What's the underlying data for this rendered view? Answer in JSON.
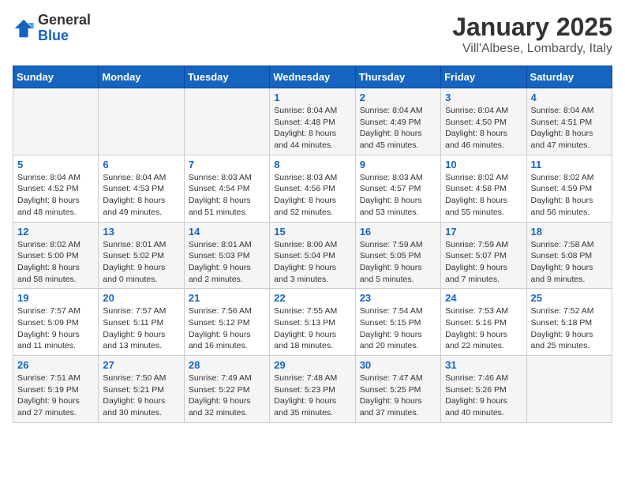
{
  "header": {
    "logo_general": "General",
    "logo_blue": "Blue",
    "title": "January 2025",
    "subtitle": "Vill'Albese, Lombardy, Italy"
  },
  "days_of_week": [
    "Sunday",
    "Monday",
    "Tuesday",
    "Wednesday",
    "Thursday",
    "Friday",
    "Saturday"
  ],
  "weeks": [
    [
      {
        "day": "",
        "info": ""
      },
      {
        "day": "",
        "info": ""
      },
      {
        "day": "",
        "info": ""
      },
      {
        "day": "1",
        "info": "Sunrise: 8:04 AM\nSunset: 4:48 PM\nDaylight: 8 hours\nand 44 minutes."
      },
      {
        "day": "2",
        "info": "Sunrise: 8:04 AM\nSunset: 4:49 PM\nDaylight: 8 hours\nand 45 minutes."
      },
      {
        "day": "3",
        "info": "Sunrise: 8:04 AM\nSunset: 4:50 PM\nDaylight: 8 hours\nand 46 minutes."
      },
      {
        "day": "4",
        "info": "Sunrise: 8:04 AM\nSunset: 4:51 PM\nDaylight: 8 hours\nand 47 minutes."
      }
    ],
    [
      {
        "day": "5",
        "info": "Sunrise: 8:04 AM\nSunset: 4:52 PM\nDaylight: 8 hours\nand 48 minutes."
      },
      {
        "day": "6",
        "info": "Sunrise: 8:04 AM\nSunset: 4:53 PM\nDaylight: 8 hours\nand 49 minutes."
      },
      {
        "day": "7",
        "info": "Sunrise: 8:03 AM\nSunset: 4:54 PM\nDaylight: 8 hours\nand 51 minutes."
      },
      {
        "day": "8",
        "info": "Sunrise: 8:03 AM\nSunset: 4:56 PM\nDaylight: 8 hours\nand 52 minutes."
      },
      {
        "day": "9",
        "info": "Sunrise: 8:03 AM\nSunset: 4:57 PM\nDaylight: 8 hours\nand 53 minutes."
      },
      {
        "day": "10",
        "info": "Sunrise: 8:02 AM\nSunset: 4:58 PM\nDaylight: 8 hours\nand 55 minutes."
      },
      {
        "day": "11",
        "info": "Sunrise: 8:02 AM\nSunset: 4:59 PM\nDaylight: 8 hours\nand 56 minutes."
      }
    ],
    [
      {
        "day": "12",
        "info": "Sunrise: 8:02 AM\nSunset: 5:00 PM\nDaylight: 8 hours\nand 58 minutes."
      },
      {
        "day": "13",
        "info": "Sunrise: 8:01 AM\nSunset: 5:02 PM\nDaylight: 9 hours\nand 0 minutes."
      },
      {
        "day": "14",
        "info": "Sunrise: 8:01 AM\nSunset: 5:03 PM\nDaylight: 9 hours\nand 2 minutes."
      },
      {
        "day": "15",
        "info": "Sunrise: 8:00 AM\nSunset: 5:04 PM\nDaylight: 9 hours\nand 3 minutes."
      },
      {
        "day": "16",
        "info": "Sunrise: 7:59 AM\nSunset: 5:05 PM\nDaylight: 9 hours\nand 5 minutes."
      },
      {
        "day": "17",
        "info": "Sunrise: 7:59 AM\nSunset: 5:07 PM\nDaylight: 9 hours\nand 7 minutes."
      },
      {
        "day": "18",
        "info": "Sunrise: 7:58 AM\nSunset: 5:08 PM\nDaylight: 9 hours\nand 9 minutes."
      }
    ],
    [
      {
        "day": "19",
        "info": "Sunrise: 7:57 AM\nSunset: 5:09 PM\nDaylight: 9 hours\nand 11 minutes."
      },
      {
        "day": "20",
        "info": "Sunrise: 7:57 AM\nSunset: 5:11 PM\nDaylight: 9 hours\nand 13 minutes."
      },
      {
        "day": "21",
        "info": "Sunrise: 7:56 AM\nSunset: 5:12 PM\nDaylight: 9 hours\nand 16 minutes."
      },
      {
        "day": "22",
        "info": "Sunrise: 7:55 AM\nSunset: 5:13 PM\nDaylight: 9 hours\nand 18 minutes."
      },
      {
        "day": "23",
        "info": "Sunrise: 7:54 AM\nSunset: 5:15 PM\nDaylight: 9 hours\nand 20 minutes."
      },
      {
        "day": "24",
        "info": "Sunrise: 7:53 AM\nSunset: 5:16 PM\nDaylight: 9 hours\nand 22 minutes."
      },
      {
        "day": "25",
        "info": "Sunrise: 7:52 AM\nSunset: 5:18 PM\nDaylight: 9 hours\nand 25 minutes."
      }
    ],
    [
      {
        "day": "26",
        "info": "Sunrise: 7:51 AM\nSunset: 5:19 PM\nDaylight: 9 hours\nand 27 minutes."
      },
      {
        "day": "27",
        "info": "Sunrise: 7:50 AM\nSunset: 5:21 PM\nDaylight: 9 hours\nand 30 minutes."
      },
      {
        "day": "28",
        "info": "Sunrise: 7:49 AM\nSunset: 5:22 PM\nDaylight: 9 hours\nand 32 minutes."
      },
      {
        "day": "29",
        "info": "Sunrise: 7:48 AM\nSunset: 5:23 PM\nDaylight: 9 hours\nand 35 minutes."
      },
      {
        "day": "30",
        "info": "Sunrise: 7:47 AM\nSunset: 5:25 PM\nDaylight: 9 hours\nand 37 minutes."
      },
      {
        "day": "31",
        "info": "Sunrise: 7:46 AM\nSunset: 5:26 PM\nDaylight: 9 hours\nand 40 minutes."
      },
      {
        "day": "",
        "info": ""
      }
    ]
  ]
}
